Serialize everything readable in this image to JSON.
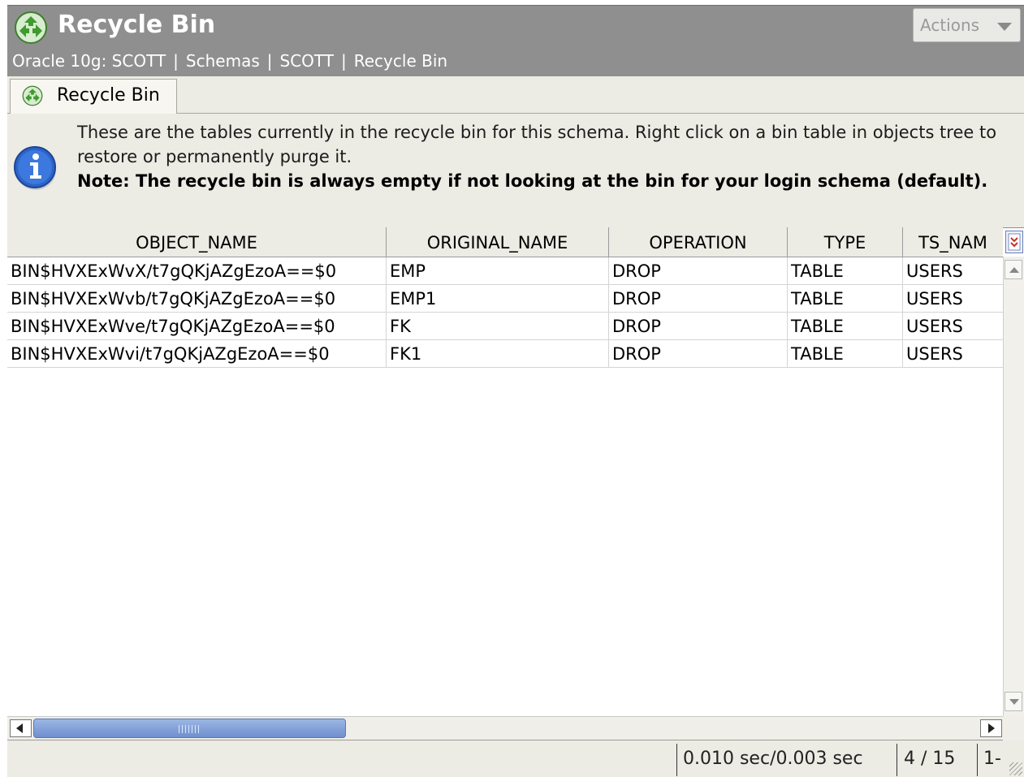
{
  "header": {
    "title": "Recycle Bin",
    "actions_label": "Actions",
    "breadcrumb": [
      "Oracle 10g: SCOTT",
      "Schemas",
      "SCOTT",
      "Recycle Bin"
    ],
    "breadcrumb_separator": "|",
    "title_icon": "recycle-icon",
    "actions_icon": "chevron-down-icon"
  },
  "tab": {
    "label": "Recycle Bin",
    "icon": "recycle-icon"
  },
  "info": {
    "icon": "info-icon",
    "text": "These are the tables currently in the recycle bin for this schema. Right click on a bin table in objects tree to restore or permanently purge it.",
    "note": "Note: The recycle bin is always empty if not looking at the bin for your login schema (default)."
  },
  "table": {
    "columns": [
      "OBJECT_NAME",
      "ORIGINAL_NAME",
      "OPERATION",
      "TYPE",
      "TS_NAM"
    ],
    "rows": [
      [
        "BIN$HVXExWvX/t7gQKjAZgEzoA==$0",
        "EMP",
        "DROP",
        "TABLE",
        "USERS"
      ],
      [
        "BIN$HVXExWvb/t7gQKjAZgEzoA==$0",
        "EMP1",
        "DROP",
        "TABLE",
        "USERS"
      ],
      [
        "BIN$HVXExWve/t7gQKjAZgEzoA==$0",
        "FK",
        "DROP",
        "TABLE",
        "USERS"
      ],
      [
        "BIN$HVXExWvi/t7gQKjAZgEzoA==$0",
        "FK1",
        "DROP",
        "TABLE",
        "USERS"
      ]
    ]
  },
  "status": {
    "timing": "0.010 sec/0.003 sec",
    "count": "4 / 15",
    "range": "1-"
  },
  "colors": {
    "header_bg": "#8f8f8f",
    "panel_bg": "#ecebe4",
    "scroll_thumb": "#7f9fd8",
    "recycle_green": "#3f9b2e",
    "info_blue": "#2d64c8"
  }
}
